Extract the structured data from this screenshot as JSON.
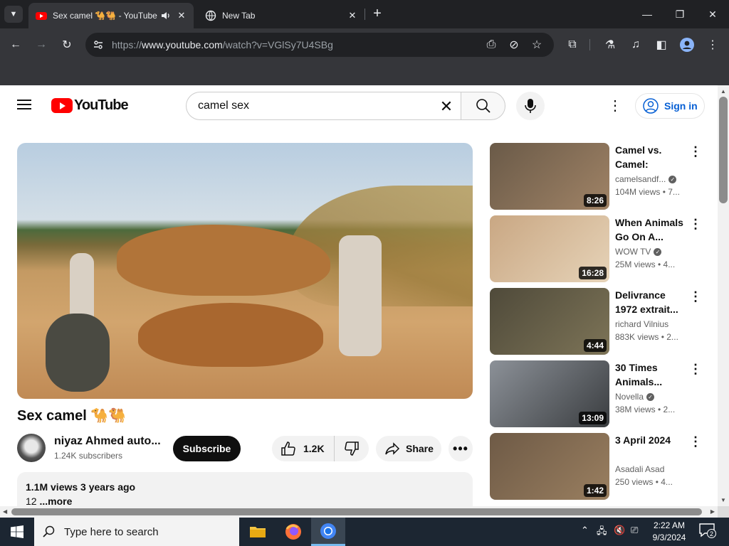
{
  "browser": {
    "tabs": [
      {
        "title": "Sex camel 🐪🐫 - YouTube",
        "active": true,
        "audio": true
      },
      {
        "title": "New Tab",
        "active": false
      }
    ],
    "url_prefix": "https://",
    "url_domain": "www.youtube.com",
    "url_path": "/watch?v=VGlSy7U4SBg"
  },
  "youtube": {
    "logo_text": "YouTube",
    "search_query": "camel sex",
    "sign_in_label": "Sign in"
  },
  "video": {
    "title": "Sex camel 🐪🐫",
    "channel_name": "niyaz Ahmed auto...",
    "subscribers": "1.24K subscribers",
    "subscribe_label": "Subscribe",
    "likes": "1.2K",
    "share_label": "Share",
    "views_date": "1.1M views  3 years ago",
    "description_snippet": "12 ",
    "more_label": "...more"
  },
  "recommendations": [
    {
      "title": "Camel vs. Camel: Animal...",
      "channel": "camelsandf...",
      "verified": true,
      "meta": "104M views  • 7...",
      "duration": "8:26",
      "thumb_colors": [
        "#6a5a48",
        "#a08366"
      ]
    },
    {
      "title": "When Animals Go On A...",
      "channel": "WOW TV",
      "verified": true,
      "meta": "25M views  • 4...",
      "duration": "16:28",
      "thumb_colors": [
        "#c9a783",
        "#e6d3b8"
      ]
    },
    {
      "title": "Delivrance 1972 extrait...",
      "channel": "richard Vilnius",
      "verified": false,
      "meta": "883K views  • 2...",
      "duration": "4:44",
      "thumb_colors": [
        "#4f4a3a",
        "#7d7457"
      ]
    },
    {
      "title": "30 Times Animals...",
      "channel": "Novella",
      "verified": true,
      "meta": "38M views  • 2...",
      "duration": "13:09",
      "thumb_colors": [
        "#8c9198",
        "#3a3d40"
      ]
    },
    {
      "title": "3 April 2024",
      "channel": "Asadali Asad",
      "verified": false,
      "meta": "250 views  • 4...",
      "duration": "1:42",
      "thumb_colors": [
        "#6e5a46",
        "#9a7f60"
      ]
    }
  ],
  "taskbar": {
    "search_placeholder": "Type here to search",
    "time": "2:22 AM",
    "date": "9/3/2024",
    "notification_count": "2"
  }
}
